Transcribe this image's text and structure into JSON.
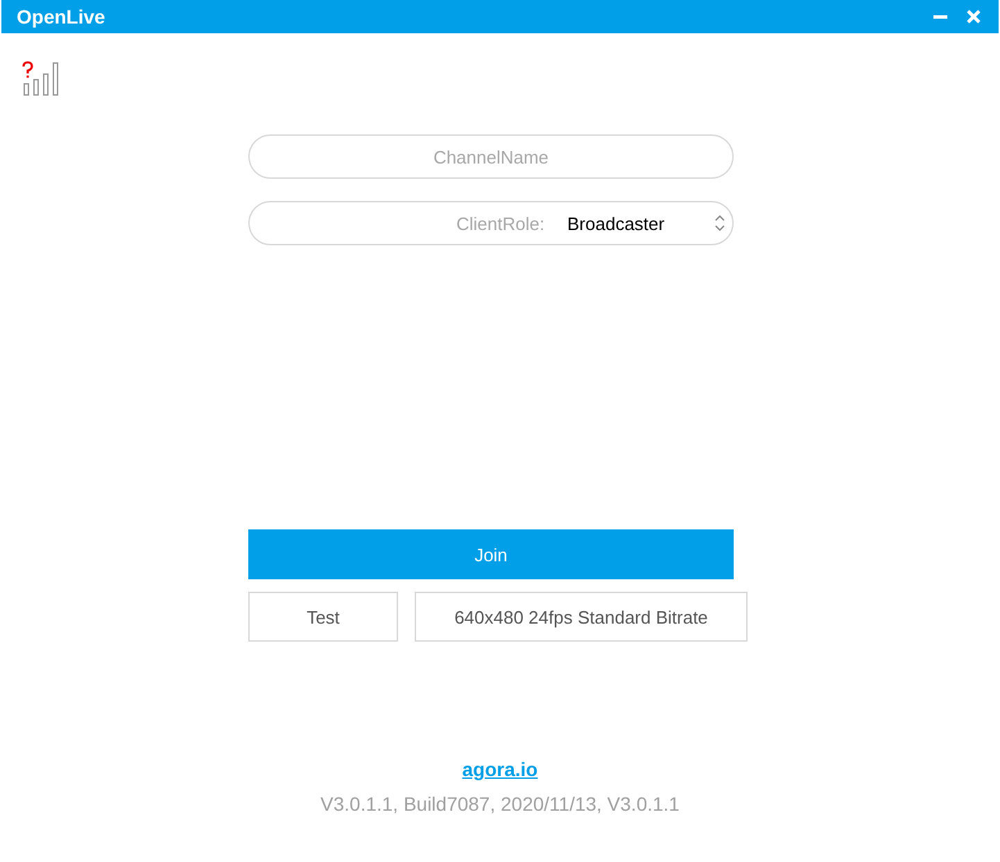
{
  "window": {
    "title": "OpenLive"
  },
  "channel_field": {
    "placeholder": "ChannelName"
  },
  "role_field": {
    "label": "ClientRole:",
    "value": "Broadcaster"
  },
  "join_button": "Join",
  "test_button": "Test",
  "video_profile_button": "640x480 24fps Standard Bitrate",
  "footer": {
    "link": "agora.io",
    "version": "V3.0.1.1, Build7087, 2020/11/13, V3.0.1.1"
  }
}
